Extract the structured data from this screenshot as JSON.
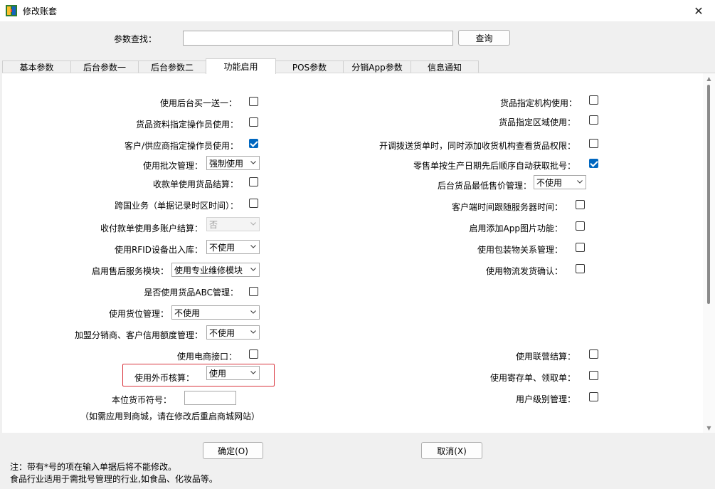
{
  "window": {
    "title": "修改账套",
    "close_glyph": "✕"
  },
  "search": {
    "label": "参数查找：",
    "value": "",
    "button": "查询"
  },
  "tabs": [
    "基本参数",
    "后台参数一",
    "后台参数二",
    "功能启用",
    "POS参数",
    "分销App参数",
    "信息通知"
  ],
  "active_tab": "功能启用",
  "left": {
    "buy_one_get_one": {
      "label": "使用后台买一送一：",
      "checked": false
    },
    "goods_operator": {
      "label": "货品资料指定操作员使用：",
      "checked": false
    },
    "customer_operator": {
      "label": "客户/供应商指定操作员使用：",
      "checked": true
    },
    "batch": {
      "label": "使用批次管理：",
      "value": "强制使用"
    },
    "receipt_settle": {
      "label": "收款单使用货品结算：",
      "checked": false
    },
    "cross_border": {
      "label": "跨国业务（单据记录时区时间）：",
      "checked": false
    },
    "multi_account": {
      "label": "收付款单使用多账户结算：",
      "value": "否"
    },
    "rfid": {
      "label": "使用RFID设备出入库：",
      "value": "不使用"
    },
    "after_sales": {
      "label": "启用售后服务模块：",
      "value": "使用专业维修模块"
    },
    "abc": {
      "label": "是否使用货品ABC管理：",
      "checked": false
    },
    "location": {
      "label": "使用货位管理：",
      "value": "不使用"
    },
    "credit": {
      "label": "加盟分销商、客户信用额度管理：",
      "value": "不使用"
    },
    "ecommerce": {
      "label": "使用电商接口：",
      "checked": false
    },
    "foreign_currency": {
      "label": "使用外币核算：",
      "value": "使用"
    },
    "currency_symbol": {
      "label": "本位货币符号：",
      "value": ""
    },
    "mall_note": "（如需应用到商城，请在修改后重启商城网站）"
  },
  "right": {
    "org_goods": {
      "label": "货品指定机构使用：",
      "checked": false
    },
    "region_goods": {
      "label": "货品指定区域使用：",
      "checked": false
    },
    "transfer_perm": {
      "label": "开调拨送货单时，同时添加收货机构查看货品权限：",
      "checked": false
    },
    "retail_batch": {
      "label": "零售单按生产日期先后顺序自动获取批号：",
      "checked": true
    },
    "min_price": {
      "label": "后台货品最低售价管理：",
      "value": "不使用"
    },
    "client_time": {
      "label": "客户端时间跟随服务器时间：",
      "checked": false
    },
    "app_image": {
      "label": "启用添加App图片功能：",
      "checked": false
    },
    "packaging": {
      "label": "使用包装物关系管理：",
      "checked": false
    },
    "logistics": {
      "label": "使用物流发货确认：",
      "checked": false
    },
    "joint_settle": {
      "label": "使用联营结算：",
      "checked": false
    },
    "consign": {
      "label": "使用寄存单、领取单：",
      "checked": false
    },
    "user_level": {
      "label": "用户级别管理：",
      "checked": false
    }
  },
  "footer": {
    "ok": "确定(O)",
    "cancel": "取消(X)",
    "note1": "注：带有*号的项在输入单据后将不能修改。",
    "note2": "食品行业适用于需批号管理的行业,如食品、化妆品等。"
  },
  "colors": {
    "accent": "#0067c0",
    "highlight_border": "#d9363e"
  },
  "icons": {
    "app": "app-icon",
    "close": "close-icon",
    "dropdown": "chevron-down-icon"
  }
}
